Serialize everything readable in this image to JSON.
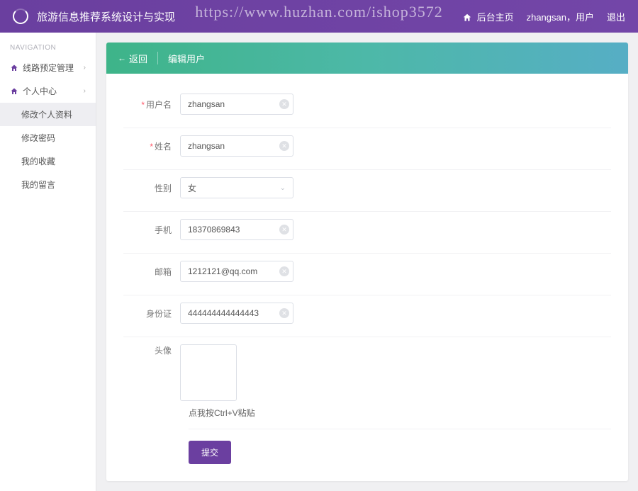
{
  "header": {
    "app_title": "旅游信息推荐系统设计与实现",
    "watermark": "https://www.huzhan.com/ishop3572",
    "nav": {
      "home": "后台主页",
      "user_label": "zhangsan，用户",
      "logout": "退出"
    }
  },
  "sidebar": {
    "header": "NAVIGATION",
    "items": [
      {
        "label": "线路预定管理",
        "icon": "home",
        "expandable": true
      },
      {
        "label": "个人中心",
        "icon": "home",
        "expandable": true
      }
    ],
    "subitems": [
      {
        "label": "修改个人资料",
        "active": true
      },
      {
        "label": "修改密码",
        "active": false
      },
      {
        "label": "我的收藏",
        "active": false
      },
      {
        "label": "我的留言",
        "active": false
      }
    ]
  },
  "panel": {
    "back": "返回",
    "title": "编辑用户"
  },
  "form": {
    "username": {
      "label": "用户名",
      "value": "zhangsan",
      "required": true
    },
    "realname": {
      "label": "姓名",
      "value": "zhangsan",
      "required": true
    },
    "gender": {
      "label": "性别",
      "value": "女"
    },
    "phone": {
      "label": "手机",
      "value": "18370869843"
    },
    "email": {
      "label": "邮箱",
      "value": "1212121@qq.com"
    },
    "idcard": {
      "label": "身份证",
      "value": "444444444444443"
    },
    "avatar": {
      "label": "头像",
      "hint": "点我按Ctrl+V粘贴"
    },
    "submit": "提交"
  }
}
